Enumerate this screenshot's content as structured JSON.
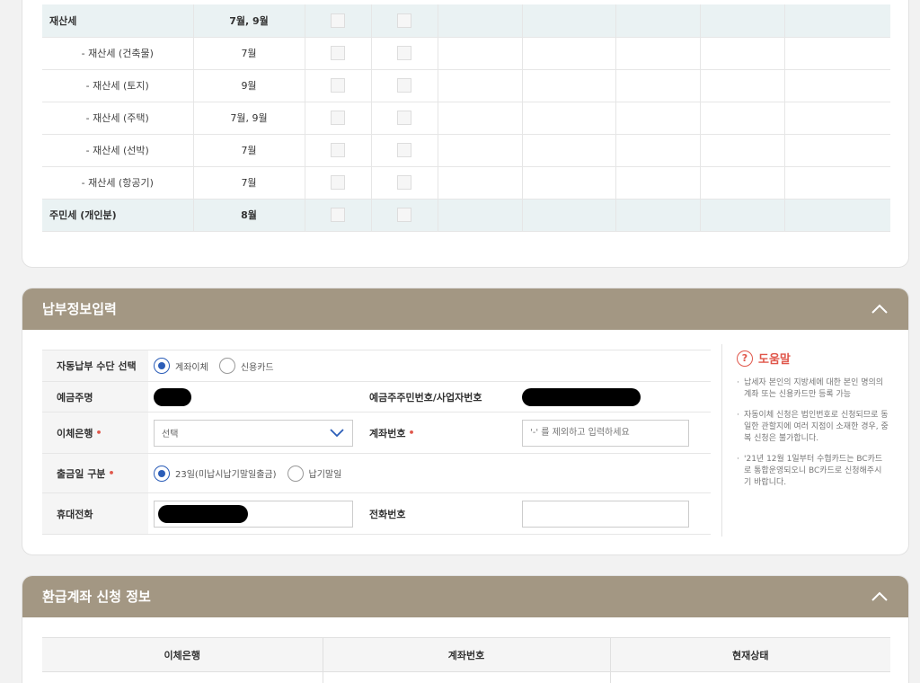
{
  "tax_table": {
    "rows": [
      {
        "name": "재산세",
        "month": "7월, 9월",
        "type": "main"
      },
      {
        "name": "- 재산세 (건축물)",
        "month": "7월",
        "type": "sub"
      },
      {
        "name": "- 재산세 (토지)",
        "month": "9월",
        "type": "sub"
      },
      {
        "name": "- 재산세 (주택)",
        "month": "7월, 9월",
        "type": "sub"
      },
      {
        "name": "- 재산세 (선박)",
        "month": "7월",
        "type": "sub"
      },
      {
        "name": "- 재산세 (항공기)",
        "month": "7월",
        "type": "sub"
      },
      {
        "name": "주민세 (개인분)",
        "month": "8월",
        "type": "main"
      }
    ]
  },
  "payment_section": {
    "title": "납부정보입력",
    "method_label": "자동납부 수단 선택",
    "method_options": [
      "계좌이체",
      "신용카드"
    ],
    "method_selected": "계좌이체",
    "account_holder_label": "예금주명",
    "holder_id_label": "예금주주민번호/사업자번호",
    "bank_label": "이체은행",
    "bank_placeholder": "선택",
    "account_no_label": "계좌번호",
    "account_no_placeholder": "'-' 를 제외하고 입력하세요",
    "withdraw_label": "출금일 구분",
    "withdraw_options": [
      "23일(미납시납기말일출금)",
      "납기말일"
    ],
    "withdraw_selected": "23일(미납시납기말일출금)",
    "mobile_label": "휴대전화",
    "phone_label": "전화번호",
    "required_mark": "•"
  },
  "help": {
    "icon": "?",
    "title": "도움말",
    "items": [
      "납세자 본인의 지방세에 대한 본인 명의의 계좌 또는 신용카드만 등록 가능",
      "자동이체 신청은 법인번호로 신청되므로 동일한 관할지에 여러 지점이 소재한 경우, 중복 신청은 불가합니다.",
      "'21년 12월 1일부터 수협카드는 BC카드로 통합운영되오니 BC카드로 신청해주시기 바랍니다."
    ]
  },
  "refund_section": {
    "title": "환급계좌 신청 정보",
    "columns": [
      "이체은행",
      "계좌번호",
      "현재상태"
    ]
  },
  "colors": {
    "header_bg": "#a39783",
    "main_row_bg": "#eaf2f3",
    "required": "#e0574b",
    "radio_on": "#2b5db8"
  }
}
